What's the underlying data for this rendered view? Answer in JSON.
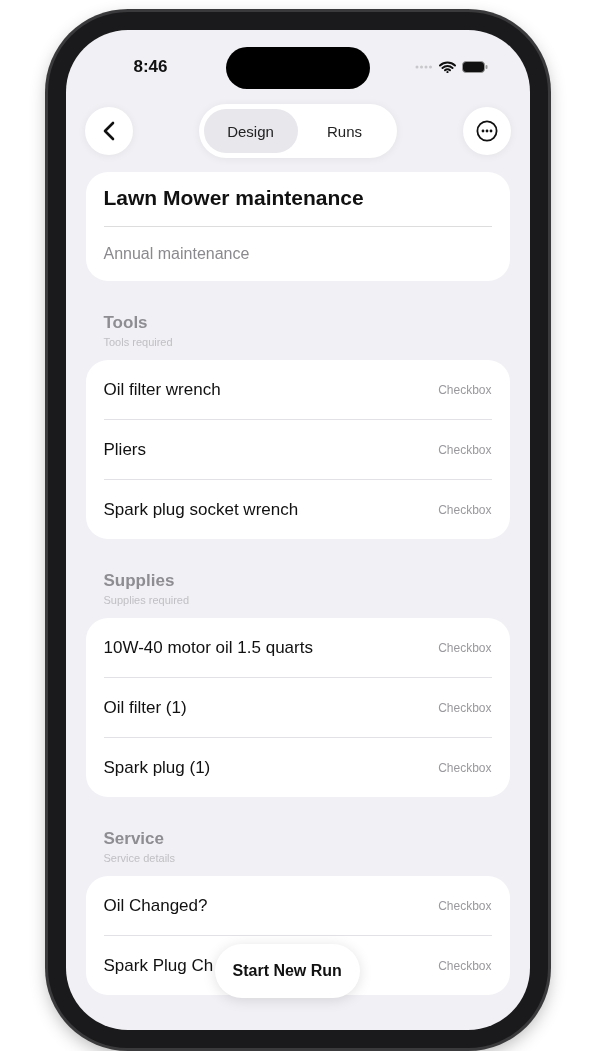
{
  "status_bar": {
    "time": "8:46"
  },
  "nav": {
    "tabs": [
      {
        "label": "Design",
        "selected": true
      },
      {
        "label": "Runs",
        "selected": false
      }
    ]
  },
  "header": {
    "title": "Lawn Mower maintenance",
    "description": "Annual maintenance"
  },
  "sections": [
    {
      "title": "Tools",
      "subtitle": "Tools required",
      "items": [
        {
          "label": "Oil filter wrench",
          "type": "Checkbox"
        },
        {
          "label": "Pliers",
          "type": "Checkbox"
        },
        {
          "label": "Spark plug socket wrench",
          "type": "Checkbox"
        }
      ]
    },
    {
      "title": "Supplies",
      "subtitle": "Supplies required",
      "items": [
        {
          "label": "10W-40 motor oil 1.5 quarts",
          "type": "Checkbox"
        },
        {
          "label": "Oil filter (1)",
          "type": "Checkbox"
        },
        {
          "label": "Spark plug (1)",
          "type": "Checkbox"
        }
      ]
    },
    {
      "title": "Service",
      "subtitle": "Service details",
      "items": [
        {
          "label": "Oil Changed?",
          "type": "Checkbox"
        },
        {
          "label": "Spark Plug Ch",
          "type": "Checkbox"
        }
      ]
    }
  ],
  "primary_button": "Start New Run"
}
